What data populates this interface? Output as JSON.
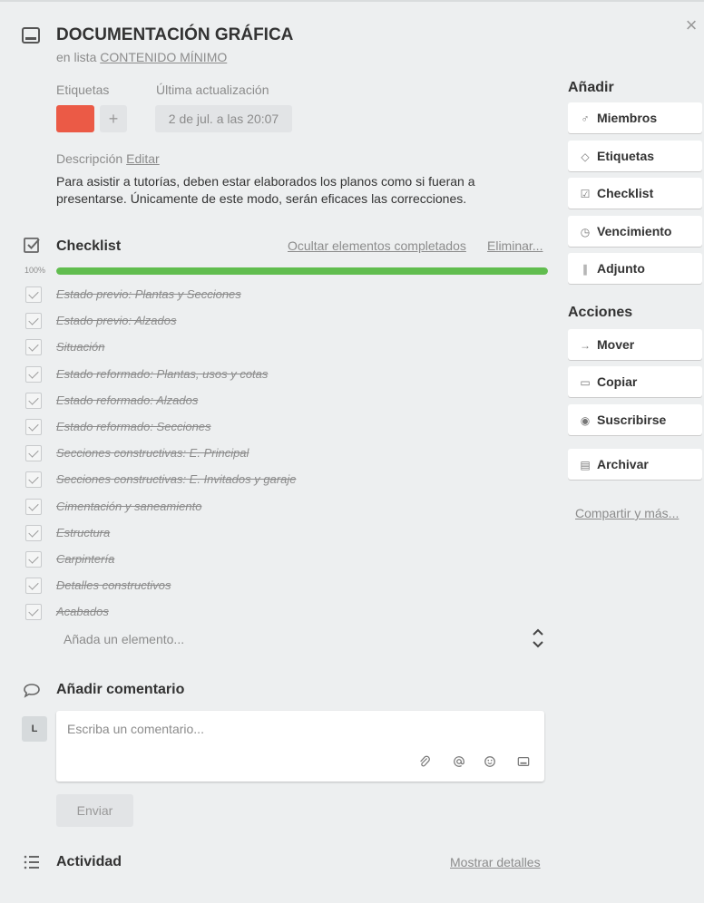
{
  "card": {
    "title": "DOCUMENTACIÓN GRÁFICA",
    "in_list_prefix": "en lista",
    "list_name": "CONTENIDO MÍNIMO",
    "close_glyph": "×"
  },
  "labels": {
    "heading": "Etiquetas",
    "color": "#eb5a46",
    "add_glyph": "+"
  },
  "last_update": {
    "heading": "Última actualización",
    "value": "2 de jul. a las 20:07"
  },
  "description": {
    "heading": "Descripción",
    "edit_link": "Editar",
    "text": "Para asistir a tutorías, deben estar elaborados los planos como si fueran a presentarse. Únicamente de este modo, serán eficaces las correcciones."
  },
  "checklist": {
    "title": "Checklist",
    "hide_link": "Ocultar elementos completados",
    "delete_link": "Eliminar...",
    "percent_label": "100%",
    "progress": 1.0,
    "items": [
      "Estado previo: Plantas y Secciones",
      "Estado previo: Alzados",
      "Situación",
      "Estado reformado: Plantas, usos y cotas",
      "Estado reformado: Alzados",
      "Estado reformado: Secciones",
      "Secciones constructivas: E. Principal",
      "Secciones constructivas: E. Invitados y garaje",
      "Cimentación y saneamiento",
      "Estructura",
      "Carpintería",
      "Detalles constructivos",
      "Acabados"
    ],
    "add_placeholder": "Añada un elemento..."
  },
  "comment": {
    "title": "Añadir comentario",
    "avatar_initial": "L",
    "placeholder": "Escriba un comentario...",
    "send_label": "Enviar"
  },
  "activity": {
    "title": "Actividad",
    "details_link": "Mostrar detalles"
  },
  "sidebar": {
    "add_heading": "Añadir",
    "add_buttons": [
      {
        "label": "Miembros",
        "icon": "person-icon"
      },
      {
        "label": "Etiquetas",
        "icon": "tag-icon"
      },
      {
        "label": "Checklist",
        "icon": "checkbox-icon"
      },
      {
        "label": "Vencimiento",
        "icon": "clock-icon"
      },
      {
        "label": "Adjunto",
        "icon": "paperclip-icon"
      }
    ],
    "actions_heading": "Acciones",
    "action_buttons": [
      {
        "label": "Mover",
        "icon": "arrow-right-icon"
      },
      {
        "label": "Copiar",
        "icon": "card-icon"
      },
      {
        "label": "Suscribirse",
        "icon": "eye-icon"
      },
      {
        "label": "Archivar",
        "icon": "archive-icon"
      }
    ],
    "share_link": "Compartir y más..."
  },
  "colors": {
    "progress": "#61bd4f",
    "background": "#edeff0"
  }
}
